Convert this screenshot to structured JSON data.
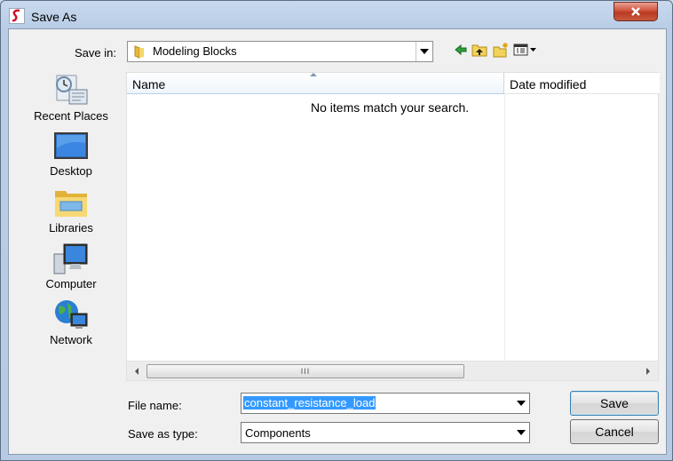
{
  "window": {
    "title": "Save As",
    "close_icon": "close-icon"
  },
  "location": {
    "label": "Save in:",
    "current_folder": "Modeling Blocks",
    "folder_icon": "folder-icon"
  },
  "toolbar": {
    "icons": [
      "back-arrow-icon",
      "up-folder-icon",
      "new-folder-icon",
      "view-menu-icon"
    ]
  },
  "places": [
    {
      "label": "Recent Places",
      "icon": "recent-places-icon"
    },
    {
      "label": "Desktop",
      "icon": "desktop-icon"
    },
    {
      "label": "Libraries",
      "icon": "libraries-icon"
    },
    {
      "label": "Computer",
      "icon": "computer-icon"
    },
    {
      "label": "Network",
      "icon": "network-icon"
    }
  ],
  "file_list": {
    "columns": [
      "Name",
      "Date modified"
    ],
    "empty_message": "No items match your search.",
    "scrollbar_grip": "III"
  },
  "form": {
    "file_name_label": "File name:",
    "file_name_value": "constant_resistance_load",
    "save_type_label": "Save as type:",
    "save_type_value": "Components"
  },
  "buttons": {
    "save": "Save",
    "cancel": "Cancel"
  },
  "colors": {
    "selection": "#3399ff",
    "close_button": "#c95a3e",
    "app_icon_accent": "#d0102a"
  }
}
